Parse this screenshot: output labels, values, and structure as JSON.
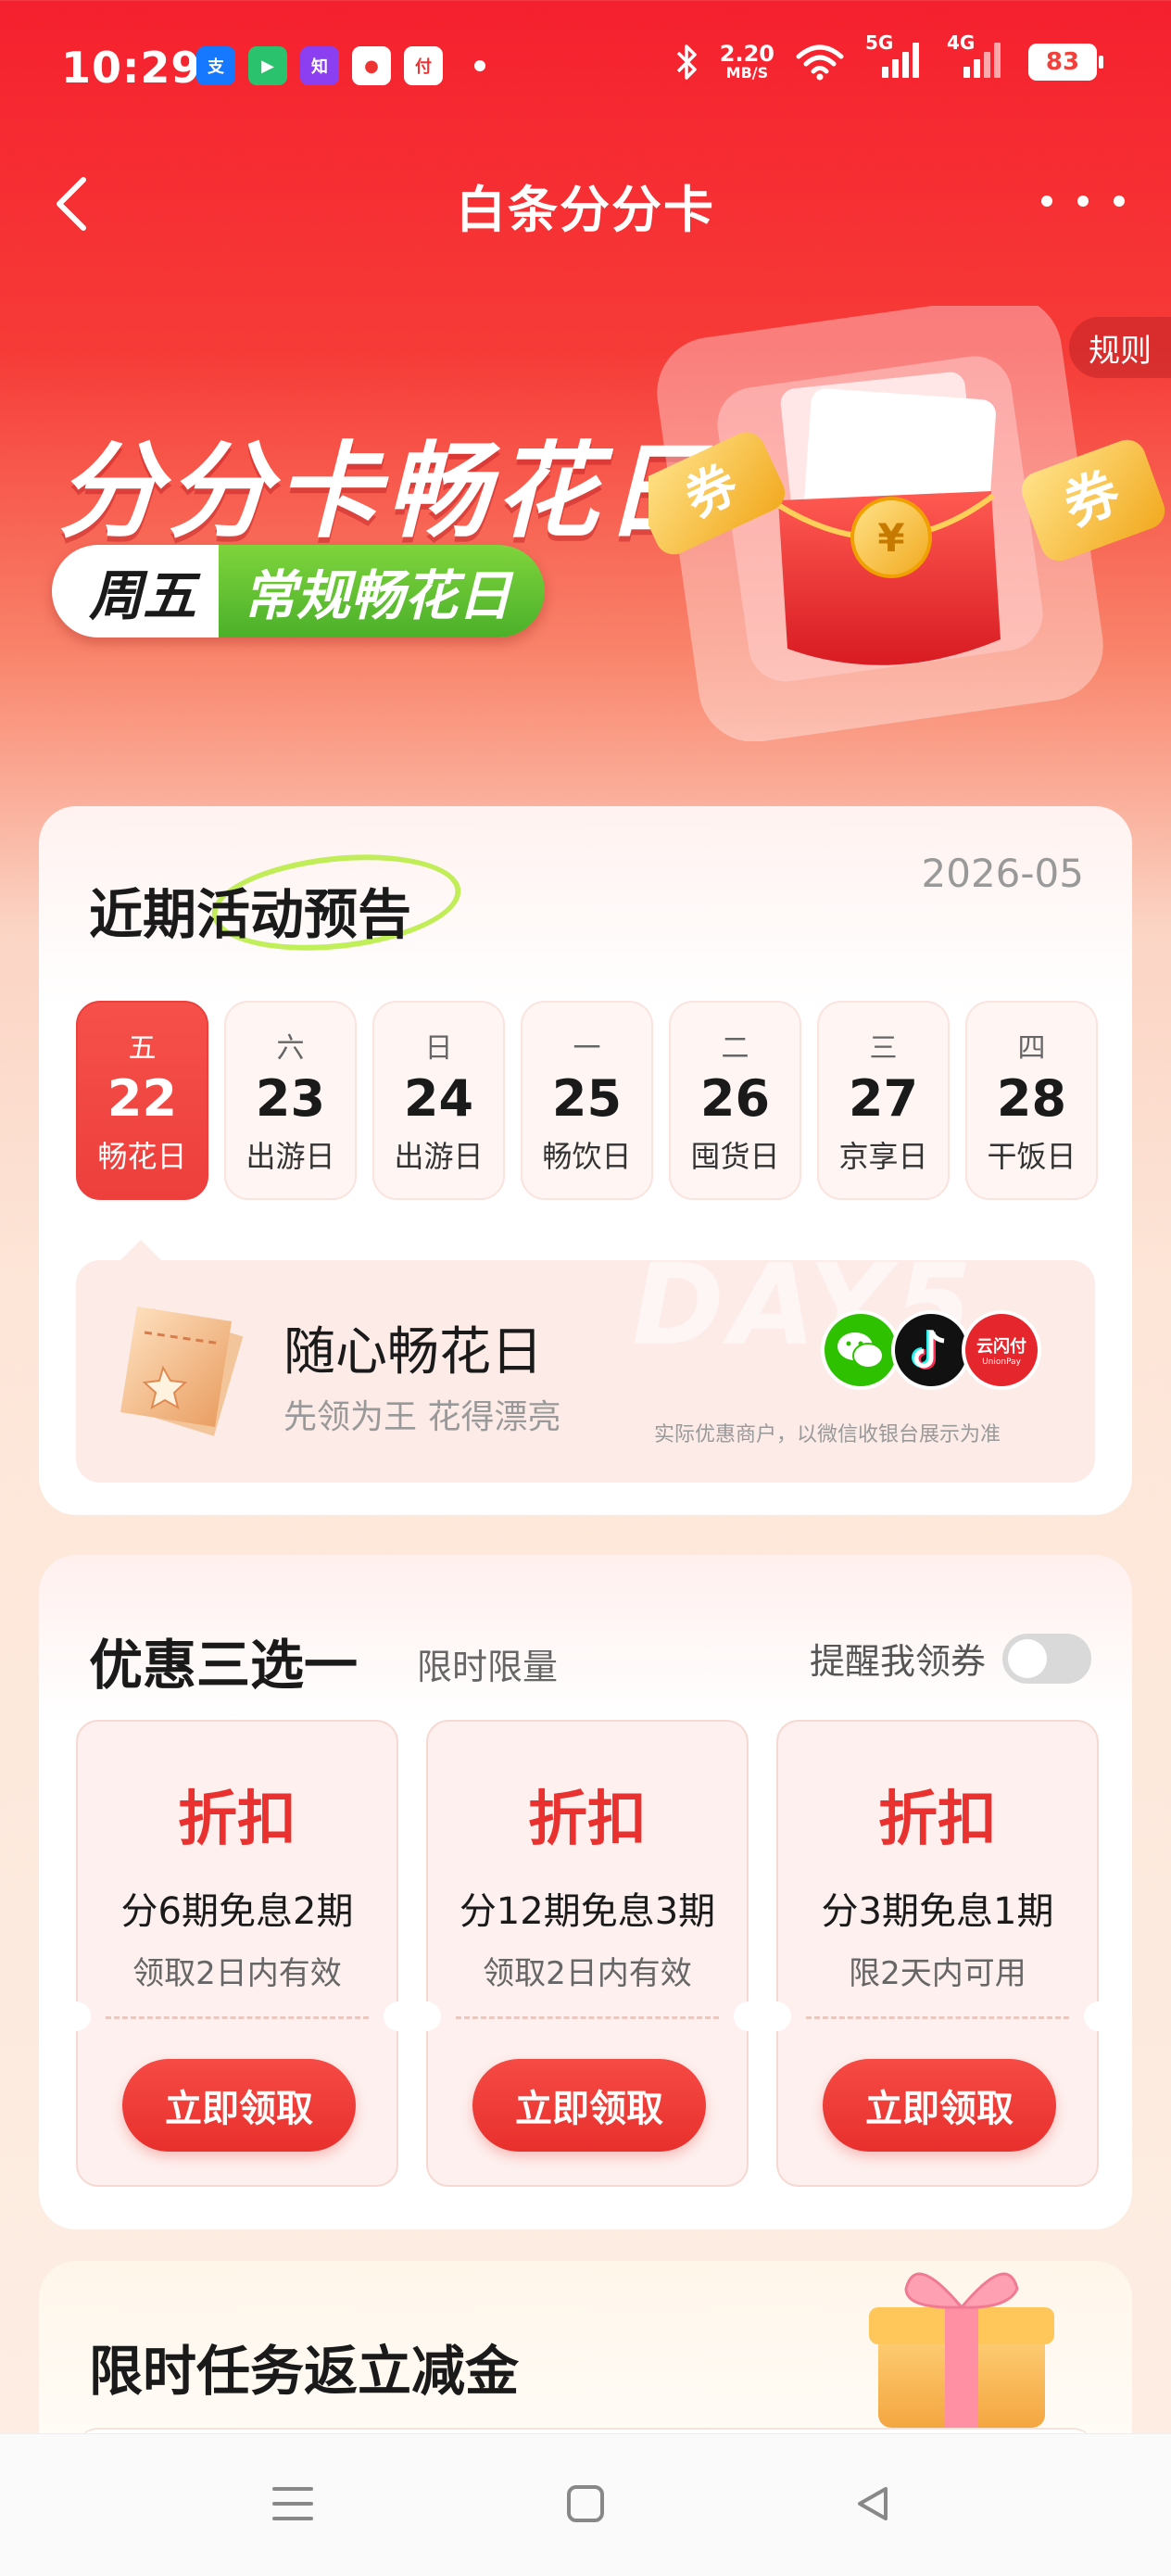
{
  "status_bar": {
    "time": "10:29",
    "speed_value": "2.20",
    "speed_unit": "MB/S",
    "net_5g": "5G",
    "net_4g": "4G",
    "battery": "83",
    "apps": [
      "alipay-icon",
      "video-icon",
      "zhibao-icon",
      "cartoon-icon",
      "payment-icon"
    ]
  },
  "header": {
    "title": "白条分分卡",
    "rules": "规则"
  },
  "hero": {
    "title": "分分卡畅花日",
    "pill_day": "周五",
    "pill_label": "常规畅花日",
    "ticket_left": "券",
    "ticket_right": "券"
  },
  "schedule": {
    "title": "近期活动预告",
    "month": "2026-05",
    "watermark": "DAY5",
    "days": [
      {
        "weekday": "五",
        "date": "22",
        "label": "畅花日",
        "active": true
      },
      {
        "weekday": "六",
        "date": "23",
        "label": "出游日",
        "active": false
      },
      {
        "weekday": "日",
        "date": "24",
        "label": "出游日",
        "active": false
      },
      {
        "weekday": "一",
        "date": "25",
        "label": "畅饮日",
        "active": false
      },
      {
        "weekday": "二",
        "date": "26",
        "label": "囤货日",
        "active": false
      },
      {
        "weekday": "三",
        "date": "27",
        "label": "京享日",
        "active": false
      },
      {
        "weekday": "四",
        "date": "28",
        "label": "干饭日",
        "active": false
      }
    ],
    "promo": {
      "title": "随心畅花日",
      "subtitle": "先领为王 花得漂亮",
      "note": "实际优惠商户，以微信收银台展示为准",
      "unionpay_text": "云闪付",
      "unionpay_sub": "UnionPay"
    }
  },
  "coupons": {
    "title": "优惠三选一",
    "subtitle": "限时限量",
    "remind_label": "提醒我领券",
    "remind_on": false,
    "items": [
      {
        "type": "折扣",
        "desc": "分6期免息2期",
        "valid": "领取2日内有效",
        "button": "立即领取"
      },
      {
        "type": "折扣",
        "desc": "分12期免息3期",
        "valid": "领取2日内有效",
        "button": "立即领取"
      },
      {
        "type": "折扣",
        "desc": "分3期免息1期",
        "valid": "限2天内可用",
        "button": "立即领取"
      }
    ]
  },
  "tasks": {
    "title": "限时任务返立减金"
  },
  "colors": {
    "brand_red": "#e9322f",
    "accent_green": "#4bb02a",
    "highlight_ring": "#b6ec3c"
  }
}
